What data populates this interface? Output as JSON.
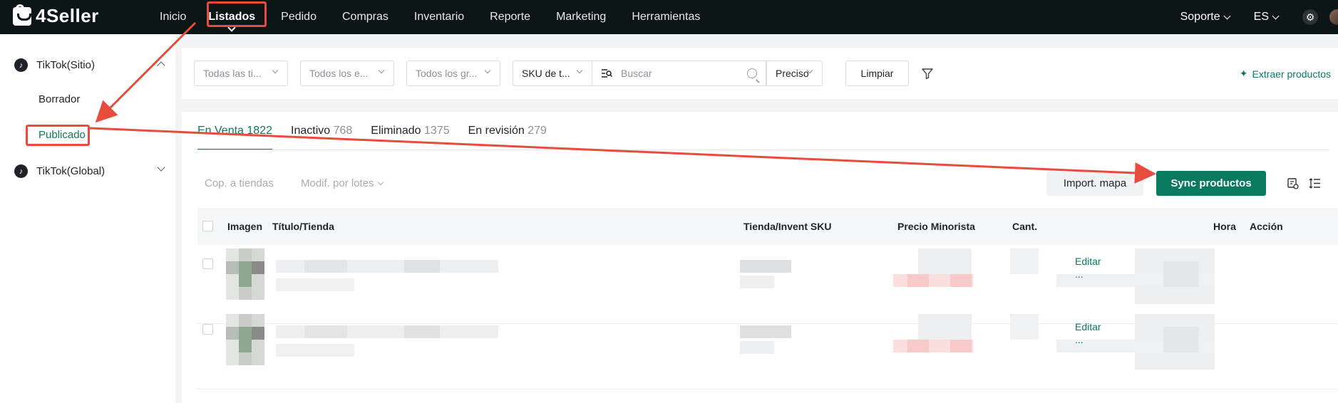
{
  "app": {
    "logo_text": "4Seller"
  },
  "nav": {
    "items": [
      {
        "label": "Inicio"
      },
      {
        "label": "Listados"
      },
      {
        "label": "Pedido"
      },
      {
        "label": "Compras"
      },
      {
        "label": "Inventario"
      },
      {
        "label": "Reporte"
      },
      {
        "label": "Marketing"
      },
      {
        "label": "Herramientas"
      }
    ],
    "support_label": "Soporte",
    "language_label": "ES",
    "settings_icon": "gear-icon"
  },
  "sidebar": {
    "group1_label": "TikTok(Sitio)",
    "group1_items": [
      {
        "label": "Borrador"
      },
      {
        "label": "Publicado"
      }
    ],
    "group2_label": "TikTok(Global)",
    "group_icon": "tiktok-icon"
  },
  "filters": {
    "shop_select": "Todas las ti...",
    "status_select": "Todos los e...",
    "group_select": "Todos los gr...",
    "search_type": "SKU de t...",
    "search_placeholder": "Buscar",
    "match_select": "Preciso",
    "clear_label": "Limpiar",
    "extract_label": "Extraer productos"
  },
  "tabs": [
    {
      "label": "En Venta",
      "count": "1822"
    },
    {
      "label": "Inactivo",
      "count": "768"
    },
    {
      "label": "Eliminado",
      "count": "1375"
    },
    {
      "label": "En revisión",
      "count": "279"
    }
  ],
  "toolbar": {
    "copy_label": "Cop. a tiendas",
    "batch_label": "Modif. por lotes",
    "import_label": "Import. mapa",
    "sync_label": "Sync productos"
  },
  "table": {
    "columns": {
      "image": "Imagen",
      "title": "Título/Tienda",
      "sku": "Tienda/Invent SKU",
      "price": "Precio Minorista",
      "qty": "Cant.",
      "time": "Hora",
      "action": "Acción"
    },
    "rows": [
      {
        "edit_label": "Editar",
        "more_label": "..."
      },
      {
        "edit_label": "Editar",
        "more_label": "..."
      }
    ]
  },
  "colors": {
    "brand_green": "#0a7a5f",
    "topbar": "#0d1616",
    "annotation_red": "#e74c3c"
  }
}
